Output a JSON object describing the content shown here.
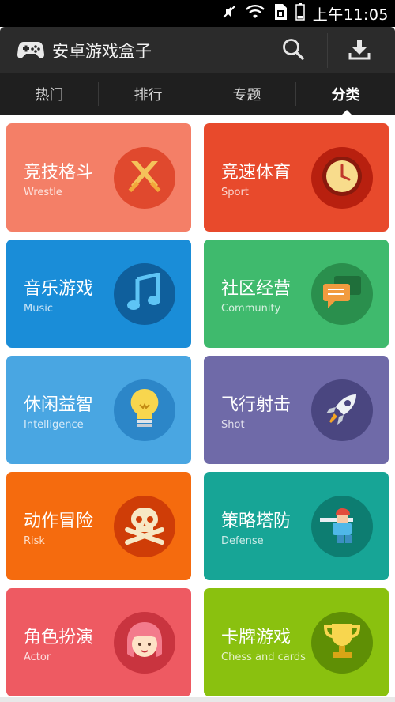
{
  "status_bar": {
    "time": "上午11:05"
  },
  "app": {
    "title": "安卓游戏盒子"
  },
  "tabs": [
    {
      "label": "热门",
      "active": false
    },
    {
      "label": "排行",
      "active": false
    },
    {
      "label": "专题",
      "active": false
    },
    {
      "label": "分类",
      "active": true
    }
  ],
  "categories": [
    {
      "cn": "竞技格斗",
      "en": "Wrestle",
      "color": "#f47f67",
      "circle": "#e0492e",
      "icon": "crossed-swords-icon"
    },
    {
      "cn": "竞速体育",
      "en": "Sport",
      "color": "#e84a2c",
      "circle": "#b8200f",
      "icon": "clock-icon"
    },
    {
      "cn": "音乐游戏",
      "en": "Music",
      "color": "#1a8dd8",
      "circle": "#0f5f9c",
      "icon": "music-note-icon"
    },
    {
      "cn": "社区经营",
      "en": "Community",
      "color": "#3fba6d",
      "circle": "#2a8f4d",
      "icon": "chat-bubbles-icon"
    },
    {
      "cn": "休闲益智",
      "en": "Intelligence",
      "color": "#49a6e2",
      "circle": "#2c86c8",
      "icon": "lightbulb-icon"
    },
    {
      "cn": "飞行射击",
      "en": "Shot",
      "color": "#6f6aa8",
      "circle": "#4a4680",
      "icon": "rocket-icon"
    },
    {
      "cn": "动作冒险",
      "en": "Risk",
      "color": "#f56b0e",
      "circle": "#cf3d07",
      "icon": "skull-icon"
    },
    {
      "cn": "策略塔防",
      "en": "Defense",
      "color": "#17a596",
      "circle": "#0d7d71",
      "icon": "soldier-icon"
    },
    {
      "cn": "角色扮演",
      "en": "Actor",
      "color": "#ee5a62",
      "circle": "#c9343f",
      "icon": "girl-face-icon"
    },
    {
      "cn": "卡牌游戏",
      "en": "Chess and cards",
      "color": "#8ac10f",
      "circle": "#5f8f05",
      "icon": "trophy-icon"
    }
  ]
}
